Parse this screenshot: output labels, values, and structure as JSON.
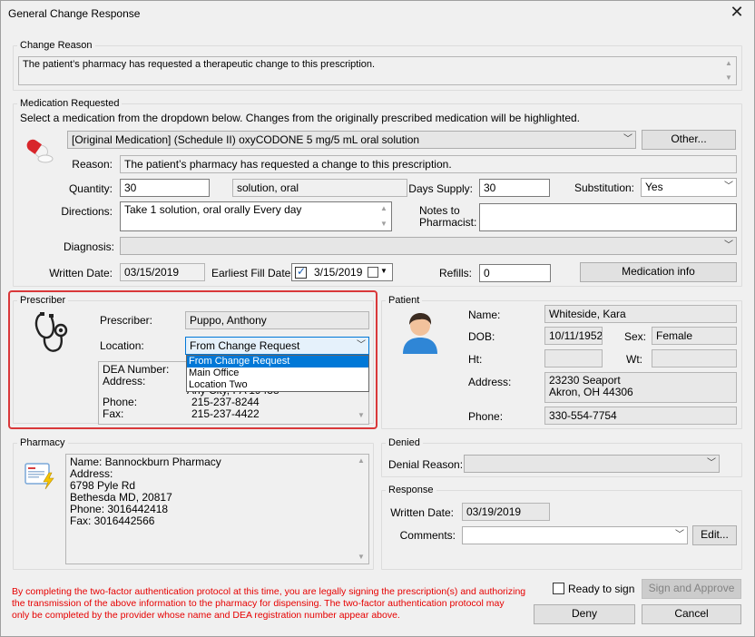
{
  "window": {
    "title": "General Change Response",
    "close_glyph": "✕"
  },
  "change_reason": {
    "group_title": "Change Reason",
    "text": "The patient’s pharmacy has requested a therapeutic change to this prescription."
  },
  "medication": {
    "group_title": "Medication Requested",
    "instruction": "Select a medication from the dropdown below. Changes from the originally prescribed medication will be highlighted.",
    "selected": "[Original Medication] (Schedule II) oxyCODONE 5 mg/5 mL oral solution",
    "other_button": "Other...",
    "reason_label": "Reason:",
    "reason_value": "The patient’s pharmacy has requested a change to this prescription.",
    "quantity_label": "Quantity:",
    "quantity_value": "30",
    "quantity_unit": "solution, oral",
    "days_supply_label": "Days Supply:",
    "days_supply_value": "30",
    "substitution_label": "Substitution:",
    "substitution_value": "Yes",
    "directions_label": "Directions:",
    "directions_value": "Take 1 solution, oral orally Every day",
    "notes_label_1": "Notes to",
    "notes_label_2": "Pharmacist:",
    "notes_value": "",
    "diagnosis_label": "Diagnosis:",
    "diagnosis_value": "",
    "written_date_label": "Written Date:",
    "written_date_value": "03/15/2019",
    "earliest_fill_label": "Earliest Fill Date:",
    "earliest_fill_value": "3/15/2019",
    "refills_label": "Refills:",
    "refills_value": "0",
    "med_info_button": "Medication info"
  },
  "prescriber": {
    "group_title": "Prescriber",
    "prescriber_label": "Prescriber:",
    "prescriber_value": "Puppo, Anthony",
    "location_label": "Location:",
    "location_value": "From Change Request",
    "location_options": [
      "From Change Request",
      "Main Office",
      "Location Two"
    ],
    "dea_label": "DEA Number:",
    "address_label": "Address:",
    "address_partial": "Any City, PA 19438",
    "phone_label": "Phone:",
    "phone_value": "215-237-8244",
    "fax_label": "Fax:",
    "fax_value": "215-237-4422"
  },
  "patient": {
    "group_title": "Patient",
    "name_label": "Name:",
    "name_value": "Whiteside, Kara",
    "dob_label": "DOB:",
    "dob_value": "10/11/1952",
    "sex_label": "Sex:",
    "sex_value": "Female",
    "ht_label": "Ht:",
    "ht_value": "",
    "wt_label": "Wt:",
    "wt_value": "",
    "address_label": "Address:",
    "address_line1": "23230 Seaport",
    "address_line2": "Akron, OH 44306",
    "phone_label": "Phone:",
    "phone_value": "330-554-7754"
  },
  "pharmacy": {
    "group_title": "Pharmacy",
    "lines": [
      "Name: Bannockburn Pharmacy",
      "Address:",
      "6798 Pyle Rd",
      "Bethesda MD, 20817",
      "Phone: 3016442418",
      "Fax: 3016442566"
    ]
  },
  "denied": {
    "group_title": "Denied",
    "reason_label": "Denial Reason:",
    "reason_value": ""
  },
  "response": {
    "group_title": "Response",
    "written_date_label": "Written Date:",
    "written_date_value": "03/19/2019",
    "comments_label": "Comments:",
    "comments_value": "",
    "edit_button": "Edit..."
  },
  "footer": {
    "legal_line1": "By completing the two-factor authentication protocol at this time, you are legally signing the prescription(s) and authorizing",
    "legal_line2": "the transmission of the above information to the pharmacy for dispensing.  The two-factor authentication protocol may",
    "legal_line3": "only be completed by the provider whose name and DEA registration number appear above.",
    "ready_label": "Ready to sign",
    "sign_button": "Sign and Approve",
    "deny_button": "Deny",
    "cancel_button": "Cancel"
  },
  "colors": {
    "accent": "#0078d7",
    "highlight_border": "#d9383a",
    "legal_text": "#e60000"
  }
}
